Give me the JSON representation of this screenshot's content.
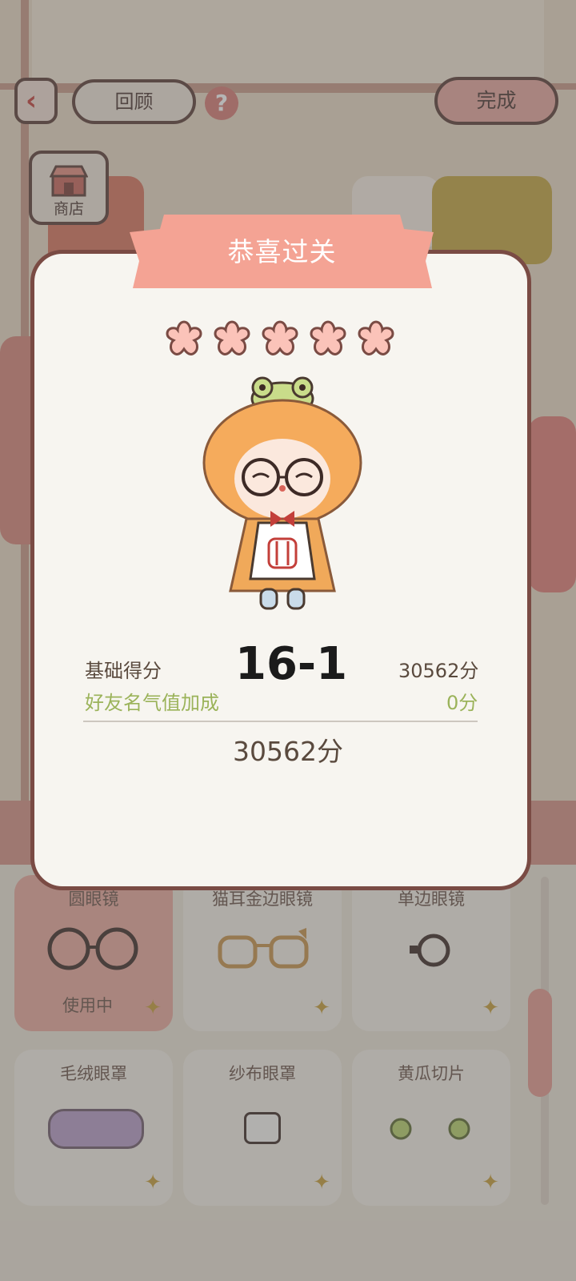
{
  "top_bar": {
    "back_icon": "chevron-left-icon",
    "review_label": "回顾",
    "help_icon": "question-icon",
    "help_glyph": "?",
    "done_label": "完成"
  },
  "shop": {
    "icon": "shop-icon",
    "label": "商店"
  },
  "modal": {
    "title": "恭喜过关",
    "stars_count": 5,
    "level": "16-1",
    "base_score_label": "基础得分",
    "base_score_value": "30562分",
    "friend_bonus_label": "好友名气值加成",
    "friend_bonus_value": "0分",
    "total_value": "30562分"
  },
  "items": [
    {
      "label": "圆眼镜",
      "status": "使用中",
      "active": true
    },
    {
      "label": "猫耳金边眼镜",
      "status": "",
      "active": false
    },
    {
      "label": "单边眼镜",
      "status": "",
      "active": false
    },
    {
      "label": "毛绒眼罩",
      "status": "",
      "active": false
    },
    {
      "label": "纱布眼罩",
      "status": "",
      "active": false
    },
    {
      "label": "黄瓜切片",
      "status": "",
      "active": false
    }
  ],
  "colors": {
    "accent": "#f4a394",
    "modal_border": "#7a4b44",
    "friend_bonus": "#9bb35a"
  }
}
